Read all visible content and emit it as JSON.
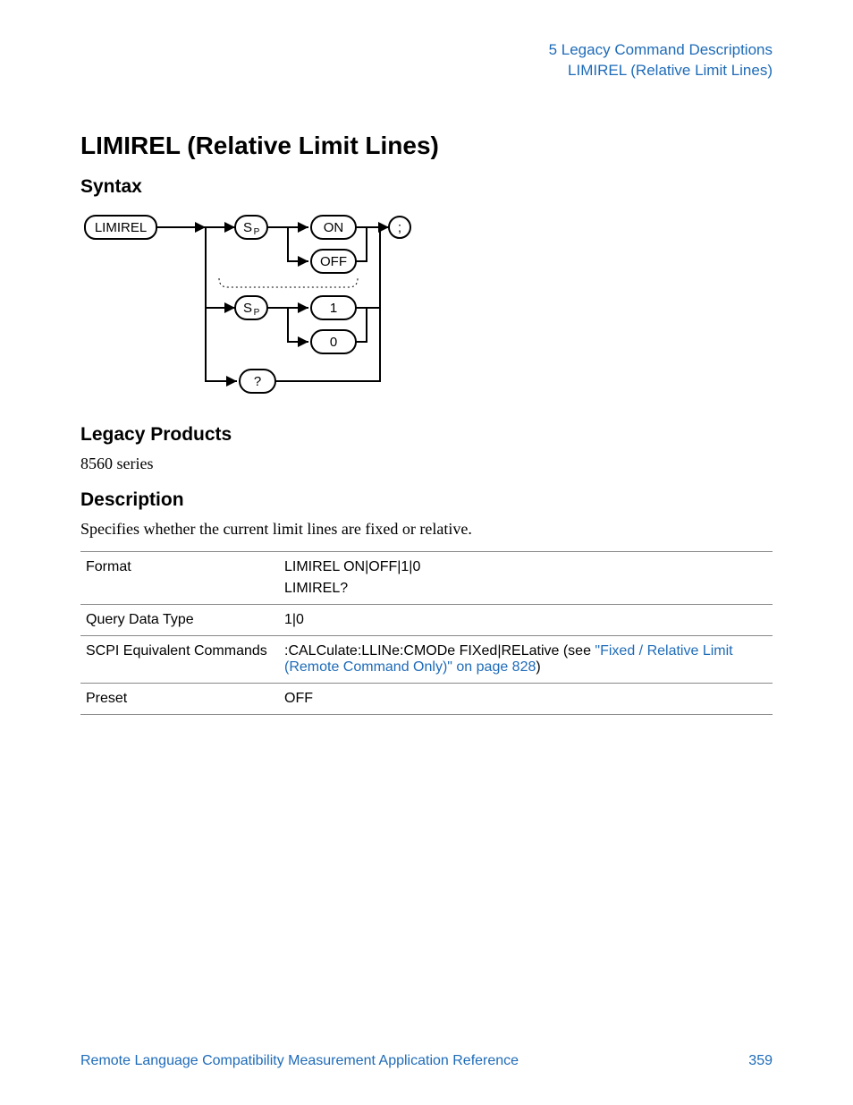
{
  "header": {
    "line1": "5  Legacy Command Descriptions",
    "line2": "LIMIREL (Relative Limit Lines)"
  },
  "title": "LIMIREL (Relative Limit Lines)",
  "sections": {
    "syntax": "Syntax",
    "legacy_products": "Legacy Products",
    "description": "Description"
  },
  "legacy_products_body": "8560 series",
  "description_body": "Specifies whether the current limit lines are fixed or relative.",
  "diagram": {
    "labels": {
      "cmd": "LIMIREL",
      "sp1": "S",
      "sp1_sub": "P",
      "sp2": "S",
      "sp2_sub": "P",
      "on": "ON",
      "off": "OFF",
      "one": "1",
      "zero": "0",
      "query": "?",
      "term": ";"
    }
  },
  "table": {
    "rows": [
      {
        "label": "Format",
        "value_line1": "LIMIREL ON|OFF|1|0",
        "value_line2": "LIMIREL?"
      },
      {
        "label": "Query Data Type",
        "value_line1": "1|0"
      },
      {
        "label": "SCPI Equivalent Commands",
        "value_prefix": ":CALCulate:LLINe:CMODe FIXed|RELative (see ",
        "value_link": "\"Fixed / Relative Limit (Remote Command Only)\" on page 828",
        "value_suffix": ")"
      },
      {
        "label": "Preset",
        "value_line1": "OFF"
      }
    ]
  },
  "footer": {
    "doc_title": "Remote Language Compatibility Measurement Application Reference",
    "page_number": "359"
  }
}
